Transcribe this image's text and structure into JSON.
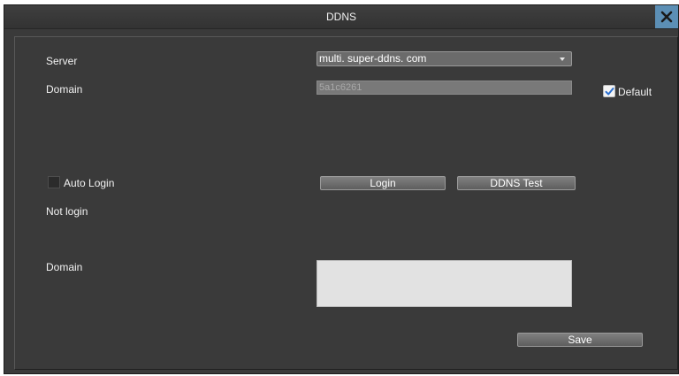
{
  "window": {
    "title": "DDNS"
  },
  "form": {
    "server_label": "Server",
    "server_value": "multi. super-ddns. com",
    "domain_label": "Domain",
    "domain_value": "5a1c6261",
    "default_label": "Default",
    "default_checked": true,
    "auto_login_label": "Auto Login",
    "auto_login_checked": false,
    "login_status": "Not login",
    "result_domain_label": "Domain",
    "result_domain_value": ""
  },
  "buttons": {
    "login": "Login",
    "ddns_test": "DDNS Test",
    "save": "Save"
  },
  "icons": {
    "close": "close-icon",
    "dropdown": "chevron-down-icon",
    "check": "check-icon"
  },
  "colors": {
    "background": "#3a3a3a",
    "close_button": "#5c8fb5",
    "check_mark": "#2a6fd0"
  }
}
